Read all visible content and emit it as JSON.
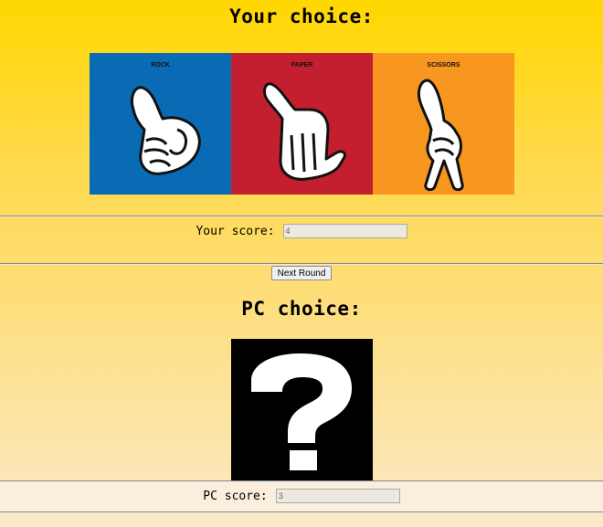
{
  "your_section": {
    "title": "Your choice:",
    "choices": [
      {
        "label": "ROCK",
        "color": "#0a6bb5"
      },
      {
        "label": "PAPER",
        "color": "#c41f2e"
      },
      {
        "label": "SCISSORS",
        "color": "#f89720"
      }
    ],
    "score_label": "Your score:",
    "score_value": "4"
  },
  "next_button": {
    "label": "Next Round"
  },
  "pc_section": {
    "title": "PC choice:",
    "choice_icon": "question-mark-icon",
    "score_label": "PC score:",
    "score_value": "3"
  }
}
